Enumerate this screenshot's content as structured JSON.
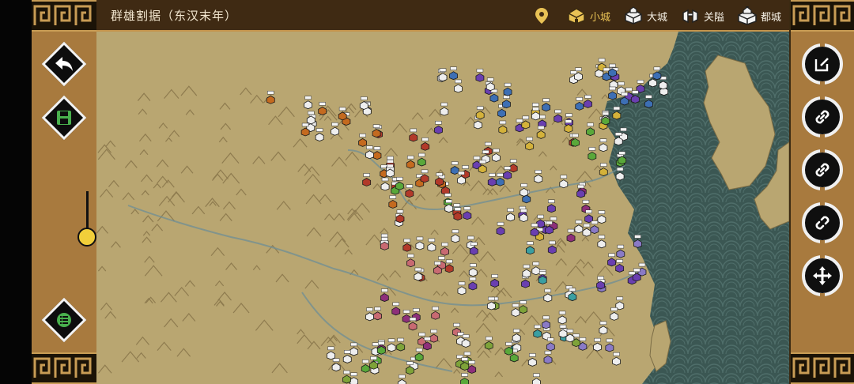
{
  "header": {
    "title": "群雄割据（东汉末年）",
    "legend": [
      {
        "label": "小城",
        "icon": "small-city-icon",
        "active": true
      },
      {
        "label": "大城",
        "icon": "big-city-icon",
        "active": false
      },
      {
        "label": "关隘",
        "icon": "pass-icon",
        "active": false
      },
      {
        "label": "都城",
        "icon": "capital-icon",
        "active": false
      }
    ]
  },
  "left_controls": {
    "back": "back-arrow-icon",
    "save": "save-icon",
    "zoom_level": 0.15,
    "menu": "list-menu-icon"
  },
  "right_controls": [
    "edit-icon",
    "link-icon",
    "link-alt-icon",
    "unlink-icon",
    "move-icon"
  ],
  "colors": {
    "panel": "#a87a3e",
    "top_bar": "#3f2a13",
    "sea": "#3b5753",
    "land": "#b9a671",
    "accent_yellow": "#f1cf3a"
  },
  "factions": {
    "white": "#eeeeee",
    "purple": "#6a3fb0",
    "blue": "#3d6fb4",
    "orange": "#c46a1f",
    "red": "#b23a2a",
    "yellow": "#d4b23a",
    "green": "#59a83a",
    "teal": "#3a9fa2",
    "pink": "#c86a72",
    "magenta": "#8e2f7a",
    "lavender": "#8a7ac6",
    "olive": "#7ea339"
  }
}
